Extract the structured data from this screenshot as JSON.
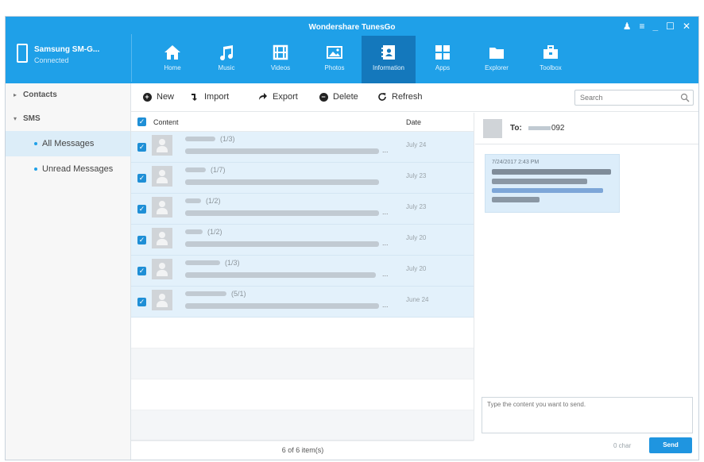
{
  "window": {
    "title": "Wondershare TunesGo",
    "controls": [
      "♟",
      "≡",
      "_",
      "☐",
      "✕"
    ]
  },
  "device": {
    "name": "Samsung SM-G...",
    "status": "Connected"
  },
  "nav": {
    "active": "Information",
    "items": [
      {
        "label": "Home",
        "icon": "home-icon"
      },
      {
        "label": "Music",
        "icon": "music-icon"
      },
      {
        "label": "Videos",
        "icon": "video-icon"
      },
      {
        "label": "Photos",
        "icon": "photo-icon"
      },
      {
        "label": "Information",
        "icon": "contact-card-icon"
      },
      {
        "label": "Apps",
        "icon": "apps-icon"
      },
      {
        "label": "Explorer",
        "icon": "folder-icon"
      },
      {
        "label": "Toolbox",
        "icon": "toolbox-icon"
      }
    ]
  },
  "sidebar": {
    "contacts": "Contacts",
    "sms": "SMS",
    "items": [
      {
        "label": "All Messages",
        "active": true
      },
      {
        "label": "Unread Messages",
        "active": false
      }
    ]
  },
  "toolbar": {
    "new": "New",
    "import": "Import",
    "export": "Export",
    "delete": "Delete",
    "refresh": "Refresh",
    "search_placeholder": "Search"
  },
  "list": {
    "col_content": "Content",
    "col_date": "Date",
    "rows": [
      {
        "count": "(1/3)",
        "date": "July 24"
      },
      {
        "count": "(1/7)",
        "date": "July 23"
      },
      {
        "count": "(1/2)",
        "date": "July 23"
      },
      {
        "count": "(1/2)",
        "date": "July 20"
      },
      {
        "count": "(1/3)",
        "date": "July 20"
      },
      {
        "count": "(5/1)",
        "date": "June 24"
      }
    ],
    "footer": "6 of 6 item(s)"
  },
  "conversation": {
    "to_label": "To:",
    "to_number": "092",
    "message_time": "7/24/2017 2:43 PM",
    "compose_placeholder": "Type the content you want to send.",
    "char_count": "0 char",
    "send": "Send"
  },
  "colors": {
    "header": "#1fa0e8",
    "active_nav": "#1478bc",
    "selected_row": "#e3f1fb",
    "checkbox": "#1f8fd6",
    "send_button": "#1f95e0"
  }
}
